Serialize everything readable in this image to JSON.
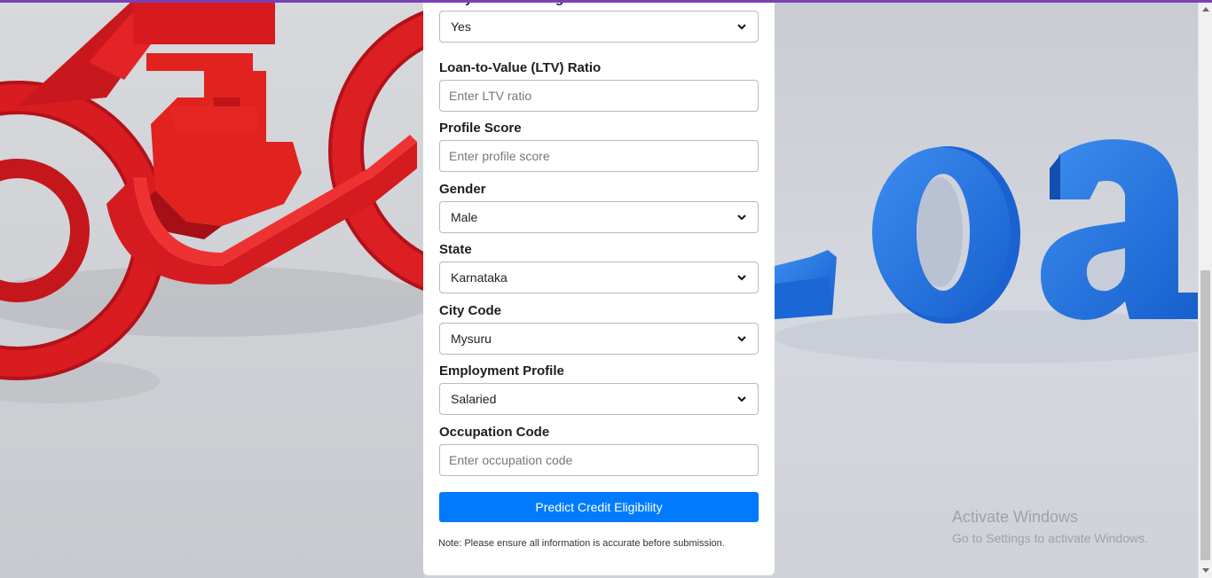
{
  "form": {
    "fields": [
      {
        "label": "Are you an Existing Customer?",
        "type": "select",
        "value": "Yes"
      },
      {
        "label": "Loan-to-Value (LTV) Ratio",
        "type": "input",
        "placeholder": "Enter LTV ratio"
      },
      {
        "label": "Profile Score",
        "type": "input",
        "placeholder": "Enter profile score"
      },
      {
        "label": "Gender",
        "type": "select",
        "value": "Male"
      },
      {
        "label": "State",
        "type": "select",
        "value": "Karnataka"
      },
      {
        "label": "City Code",
        "type": "select",
        "value": "Mysuru"
      },
      {
        "label": "Employment Profile",
        "type": "select",
        "value": "Salaried"
      },
      {
        "label": "Occupation Code",
        "type": "input",
        "placeholder": "Enter occupation code"
      }
    ],
    "submit_label": "Predict Credit Eligibility",
    "note": "Note: Please ensure all information is accurate before submission."
  },
  "watermark": {
    "title": "Activate Windows",
    "subtitle": "Go to Settings to activate Windows."
  },
  "background": {
    "left_image": "red-motorcycle",
    "right_image": "blue-loan-letters",
    "right_text": "Loa"
  },
  "colors": {
    "accent": "#7b3fb8",
    "button": "#007bff",
    "motorcycle_red": "#d61a1a",
    "letters_blue": "#1e6fe0"
  }
}
